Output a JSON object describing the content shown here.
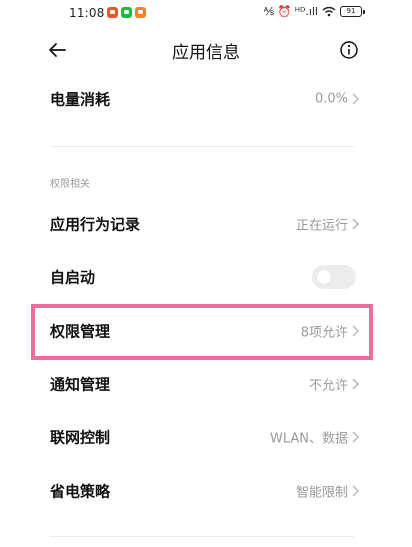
{
  "status_bar": {
    "time": "11:08",
    "indicators": "⅍ ⏰ ᴴᴰ.ıll",
    "battery": "91",
    "notification_colors": [
      "#f2542d",
      "#1fb842",
      "#f2802a"
    ]
  },
  "header": {
    "title": "应用信息",
    "back_icon": "back-arrow-icon",
    "info_icon": "info-icon"
  },
  "rows": {
    "battery_usage": {
      "label": "电量消耗",
      "value": "0.0%"
    },
    "section_permissions": "权限相关",
    "app_behavior": {
      "label": "应用行为记录",
      "value": "正在运行"
    },
    "autostart": {
      "label": "自启动",
      "enabled": false
    },
    "permissions": {
      "label": "权限管理",
      "value": "8项允许"
    },
    "notifications": {
      "label": "通知管理",
      "value": "不允许"
    },
    "network": {
      "label": "联网控制",
      "value": "WLAN、数据"
    },
    "power_saving": {
      "label": "省电策略",
      "value": "智能限制"
    }
  },
  "colors": {
    "highlight": "#f06a9b",
    "secondary_text": "#9a9a9a",
    "toggle_off": "#ececec"
  }
}
